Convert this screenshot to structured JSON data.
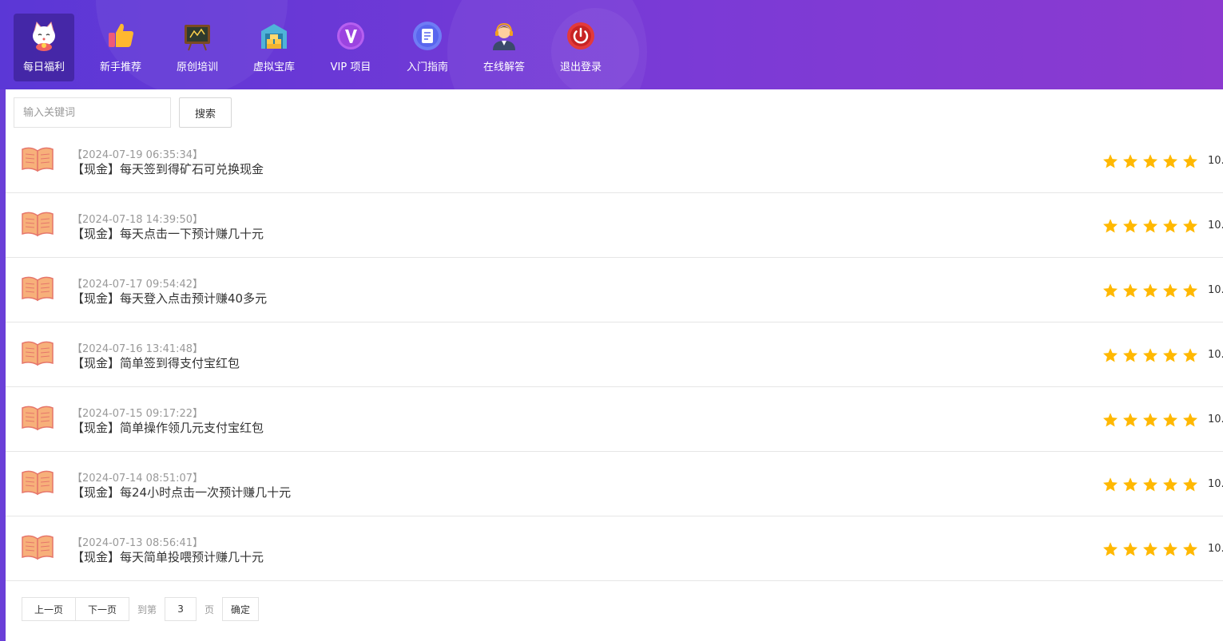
{
  "nav": {
    "items": [
      {
        "label": "每日福利",
        "icon": "lucky-cat-icon",
        "active": true
      },
      {
        "label": "新手推荐",
        "icon": "thumbs-up-icon",
        "active": false
      },
      {
        "label": "原创培训",
        "icon": "blackboard-icon",
        "active": false
      },
      {
        "label": "虚拟宝库",
        "icon": "warehouse-icon",
        "active": false
      },
      {
        "label": "VIP 项目",
        "icon": "vip-icon",
        "active": false
      },
      {
        "label": "入门指南",
        "icon": "document-icon",
        "active": false
      },
      {
        "label": "在线解答",
        "icon": "support-agent-icon",
        "active": false
      },
      {
        "label": "退出登录",
        "icon": "power-icon",
        "active": false
      }
    ]
  },
  "search": {
    "placeholder": "输入关键词",
    "value": "",
    "button_label": "搜索"
  },
  "list": {
    "items": [
      {
        "date": "【2024-07-19 06:35:34】",
        "title": "【现金】每天签到得矿石可兑换现金",
        "rating": 5,
        "score": "10."
      },
      {
        "date": "【2024-07-18 14:39:50】",
        "title": "【现金】每天点击一下预计赚几十元",
        "rating": 5,
        "score": "10."
      },
      {
        "date": "【2024-07-17 09:54:42】",
        "title": "【现金】每天登入点击预计赚40多元",
        "rating": 5,
        "score": "10."
      },
      {
        "date": "【2024-07-16 13:41:48】",
        "title": "【现金】简单签到得支付宝红包",
        "rating": 5,
        "score": "10."
      },
      {
        "date": "【2024-07-15 09:17:22】",
        "title": "【现金】简单操作领几元支付宝红包",
        "rating": 5,
        "score": "10."
      },
      {
        "date": "【2024-07-14 08:51:07】",
        "title": "【现金】每24小时点击一次预计赚几十元",
        "rating": 5,
        "score": "10."
      },
      {
        "date": "【2024-07-13 08:56:41】",
        "title": "【现金】每天简单投喂预计赚几十元",
        "rating": 5,
        "score": "10."
      }
    ]
  },
  "pager": {
    "prev_label": "上一页",
    "next_label": "下一页",
    "goto_label": "到第",
    "page_value": "3",
    "page_suffix": "页",
    "confirm_label": "确定"
  },
  "colors": {
    "header_start": "#5b37d6",
    "header_end": "#8c3ad0",
    "star": "#ffb800",
    "book": "#f7b07a"
  }
}
